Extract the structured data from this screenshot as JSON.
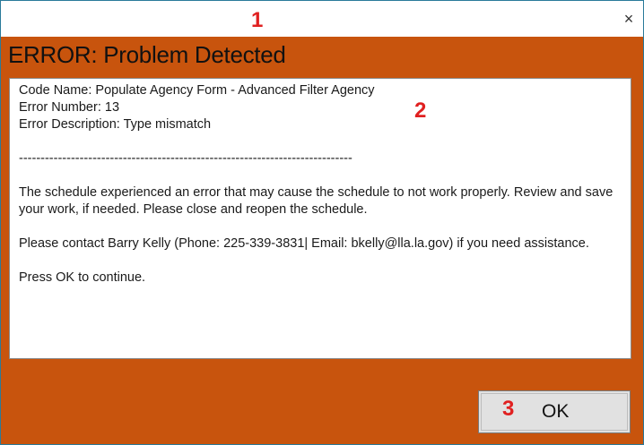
{
  "titlebar": {
    "close_label": "×",
    "annotation": "1"
  },
  "dialog": {
    "heading": "ERROR: Problem Detected",
    "annotation": "2",
    "background_color": "#c8540d",
    "message": {
      "code_name": "Code Name: Populate Agency Form - Advanced Filter Agency",
      "error_number": "Error Number: 13",
      "error_description": "Error Description: Type mismatch",
      "separator": "-----------------------------------------------------------------------------",
      "body": "The schedule experienced an error that may cause the schedule to not work properly. Review and save your work, if needed. Please close and reopen the schedule.",
      "contact": "Please contact Barry Kelly (Phone: 225-339-3831| Email: bkelly@lla.la.gov) if you need assistance.",
      "continue": "Press OK to continue."
    }
  },
  "ok_button": {
    "label": "OK",
    "annotation": "3"
  },
  "marker_color": "#e02020"
}
